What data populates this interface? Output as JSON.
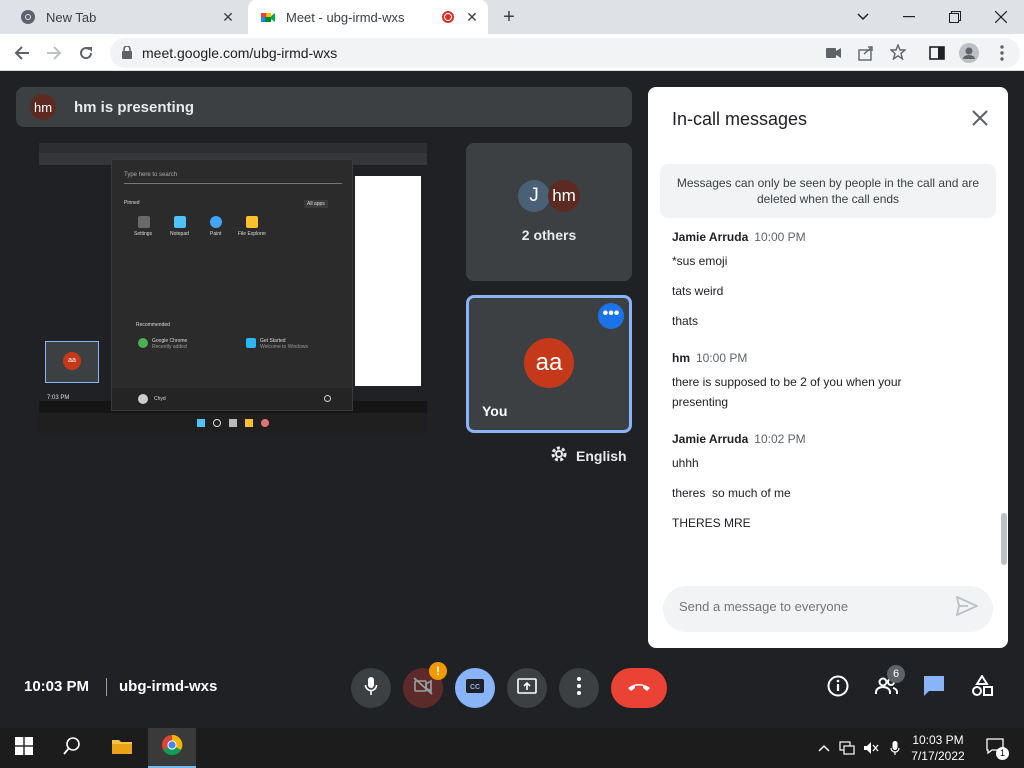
{
  "browser": {
    "tabs": [
      {
        "title": "New Tab",
        "active": false
      },
      {
        "title": "Meet - ubg-irmd-wxs",
        "active": true
      }
    ],
    "url": "meet.google.com/ubg-irmd-wxs"
  },
  "meet": {
    "presenting": {
      "avatar_initials": "hm",
      "text": "hm is presenting"
    },
    "tiles": {
      "others": {
        "avatar1": "J",
        "avatar2": "hm",
        "label": "2 others"
      },
      "you": {
        "avatar": "aa",
        "label": "You"
      }
    },
    "captions_language": "English",
    "chat": {
      "title": "In-call messages",
      "notice": "Messages can only be seen by people in the call and are deleted when the call ends",
      "groups": [
        {
          "sender": "Jamie Arruda",
          "time": "10:00 PM",
          "messages": [
            "*sus emoji",
            "tats weird",
            "thats"
          ]
        },
        {
          "sender": "hm",
          "time": "10:00 PM",
          "messages": [
            "there is supposed to be 2 of you when your presenting"
          ]
        },
        {
          "sender": "Jamie Arruda",
          "time": "10:02 PM",
          "messages": [
            "uhhh",
            "theres  so much of me",
            "THERES MRE"
          ]
        }
      ],
      "composer_placeholder": "Send a message to everyone"
    },
    "bottom": {
      "time": "10:03 PM",
      "meeting_code": "ubg-irmd-wxs",
      "participants_count": "6",
      "camera_warning": "!"
    }
  },
  "screen_share": {
    "search_placeholder": "Type here to search",
    "pinned_label": "Pinned",
    "all_apps": "All apps",
    "pinned_apps": [
      "Settings",
      "Notepad",
      "Paint",
      "File Explorer"
    ],
    "recommended_label": "Recommended",
    "recommended": [
      {
        "name": "Google Chrome",
        "sub": "Recently added"
      },
      {
        "name": "Get Started",
        "sub": "Welcome to Windows"
      }
    ],
    "mini_time": "7:03 PM",
    "mini_avatar": "aa",
    "mini_user": "Chyd"
  },
  "taskbar": {
    "time": "10:03 PM",
    "date": "7/17/2022",
    "notification_count": "1"
  },
  "colors": {
    "meet_bg": "#202124",
    "tile_bg": "#3c4043",
    "accent_blue": "#8ab4f8",
    "end_call_red": "#ea4335",
    "avatar_orange": "#c5391a"
  }
}
